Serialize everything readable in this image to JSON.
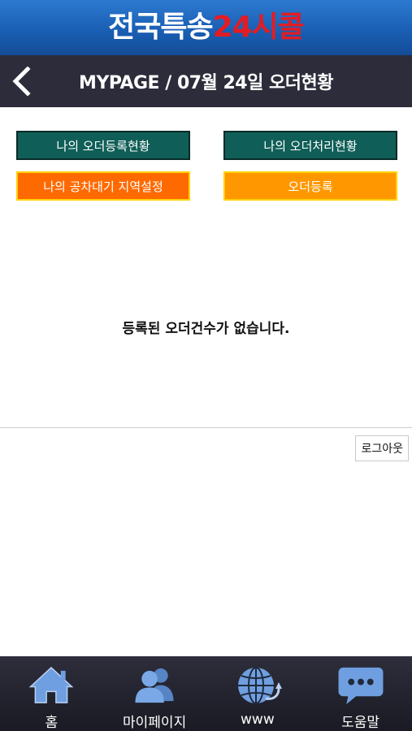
{
  "brand": {
    "part_white": "전국특송",
    "part_red": "24시콜"
  },
  "header": {
    "title": "MYPAGE / 07월 24일 오더현황"
  },
  "buttons": {
    "my_order_reg_status": "나의 오더등록현황",
    "my_order_proc_status": "나의 오더처리현황",
    "standby_region_setting": "나의 공차대기 지역설정",
    "order_register": "오더등록"
  },
  "empty_message": "등록된 오더건수가 없습니다.",
  "logout_label": "로그아웃",
  "tabbar": {
    "items": [
      {
        "label": "홈",
        "icon": "home-icon"
      },
      {
        "label": "마이페이지",
        "icon": "users-icon"
      },
      {
        "label": "www",
        "icon": "globe-icon"
      },
      {
        "label": "도움말",
        "icon": "chat-bubble-icon"
      }
    ]
  },
  "colors": {
    "brand_blue": "#1a5fb4",
    "brand_red": "#e31c23",
    "titlebar": "#2c2c3a",
    "teal_button": "#0f5e57",
    "orange_button": "#ff6a00",
    "amber_button": "#ff9800",
    "tab_icon": "#6f9fe0"
  }
}
